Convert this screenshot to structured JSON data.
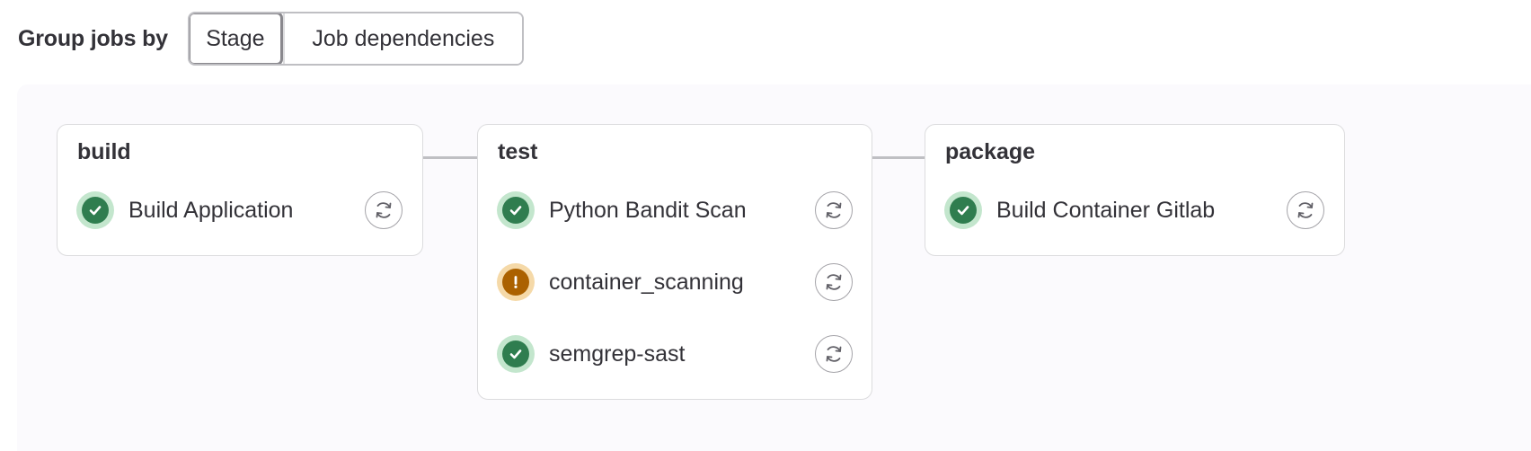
{
  "toolbar": {
    "group_label": "Group jobs by",
    "options": [
      {
        "label": "Stage",
        "selected": true
      },
      {
        "label": "Job dependencies",
        "selected": false
      }
    ]
  },
  "stages": [
    {
      "name": "build",
      "jobs": [
        {
          "name": "Build Application",
          "status": "success",
          "icon": "check-icon",
          "action_icon": "retry-icon"
        }
      ]
    },
    {
      "name": "test",
      "jobs": [
        {
          "name": "Python Bandit Scan",
          "status": "success",
          "icon": "check-icon",
          "action_icon": "retry-icon"
        },
        {
          "name": "container_scanning",
          "status": "warning",
          "icon": "exclamation-icon",
          "action_icon": "retry-icon"
        },
        {
          "name": "semgrep-sast",
          "status": "success",
          "icon": "check-icon",
          "action_icon": "retry-icon"
        }
      ]
    },
    {
      "name": "package",
      "jobs": [
        {
          "name": "Build Container Gitlab",
          "status": "success",
          "icon": "check-icon",
          "action_icon": "retry-icon"
        }
      ]
    }
  ],
  "colors": {
    "success": "#2f7d4f",
    "success_bg": "#c3e6cd",
    "warning": "#ab6100",
    "warning_bg": "#f5d9a8",
    "text": "#333238",
    "border": "#dcdcde",
    "canvas_bg": "#fbfafd"
  }
}
